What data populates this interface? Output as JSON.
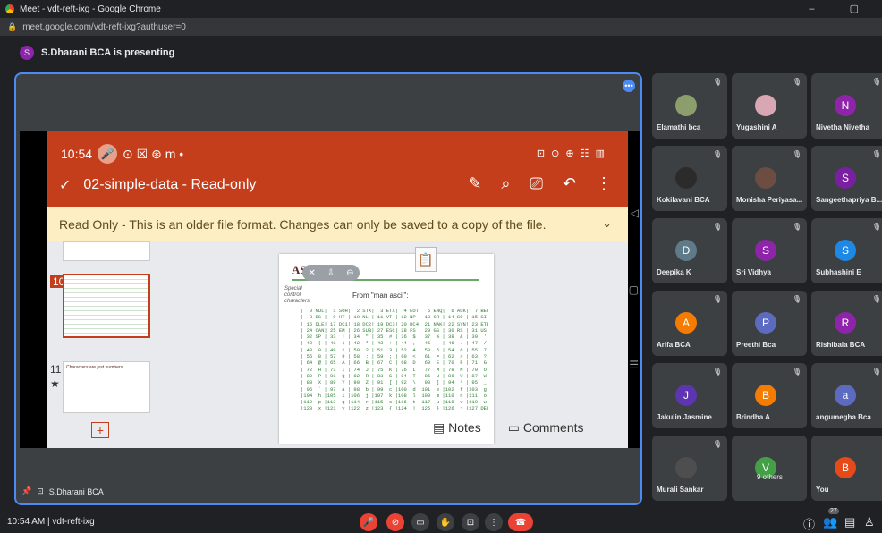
{
  "browser": {
    "title": "Meet - vdt-reft-ixg - Google Chrome",
    "url": "meet.google.com/vdt-reft-ixg?authuser=0",
    "window_controls": "–  ▢"
  },
  "presenter": {
    "initial": "S",
    "text": "S.Dharani BCA is presenting",
    "footer_name": "S.Dharani BCA"
  },
  "phone": {
    "time": "10:54",
    "status_icons": "⊙ ☒ ⊛ m •",
    "sys_icons": "⊡ ⊙ ⊕ ☷ ▥",
    "file_title": "02-simple-data - Read-only",
    "banner": "Read Only - This is an older file format. Changes can only be saved to a copy of the file.",
    "thumb_numbers": [
      "10",
      "11"
    ],
    "thumb11_title": "Characters are just numbers",
    "slide_title": "ASCII",
    "special_label": "Special control characters",
    "from_text": "From \"man ascii\":",
    "notes": "Notes",
    "comments": "Comments"
  },
  "ascii_rows": [
    "|  0 NUL|  1 SOH|  2 STX|  3 ETX|  4 EOT|  5 ENQ|  6 ACK|  7 BEL|",
    "|  8 BS |  9 HT | 10 NL | 11 VT | 12 NP | 13 CR | 14 SO | 15 SI |",
    "| 16 DLE| 17 DC1| 18 DC2| 19 DC3| 20 DC4| 21 NAK| 22 SYN| 23 ETB|",
    "| 24 CAN| 25 EM | 26 SUB| 27 ESC| 28 FS | 29 GS | 30 RS | 31 US |",
    "| 32 SP | 33  ! | 34  \" | 35  # | 36  $ | 37  % | 38  & | 39  ' |",
    "| 40  ( | 41  ) | 42  * | 43  + | 44  , | 45  - | 46  . | 47  / |",
    "| 48  0 | 49  1 | 50  2 | 51  3 | 52  4 | 53  5 | 54  6 | 55  7 |",
    "| 56  8 | 57  9 | 58  : | 59  ; | 60  < | 61  = | 62  > | 63  ? |",
    "| 64  @ | 65  A | 66  B | 67  C | 68  D | 69  E | 70  F | 71  G |",
    "| 72  H | 73  I | 74  J | 75  K | 76  L | 77  M | 78  N | 79  O |",
    "| 80  P | 81  Q | 82  R | 83  S | 84  T | 85  U | 86  V | 87  W |",
    "| 88  X | 89  Y | 90  Z | 91  [ | 92  \\ | 93  ] | 94  ^ | 95  _ |",
    "| 96  ` | 97  a | 98  b | 99  c |100  d |101  e |102  f |103  g |",
    "|104  h |105  i |106  j |107  k |108  l |109  m |110  n |111  o |",
    "|112  p |113  q |114  r |115  s |116  t |117  u |118  v |119  w |",
    "|120  x |121  y |122  z |123  { |124  | |125  } |126  ~ |127 DEL|"
  ],
  "participants": [
    {
      "name": "Elamathi bca",
      "initial": "",
      "color": "#8b9e6b"
    },
    {
      "name": "Yugashini A",
      "initial": "",
      "color": "#d9a6b3"
    },
    {
      "name": "Nivetha Nivetha",
      "initial": "N",
      "color": "#8e24aa"
    },
    {
      "name": "Kokilavani BCA",
      "initial": "",
      "color": "#2b2b2b"
    },
    {
      "name": "Monisha Periyasa...",
      "initial": "",
      "color": "#6d4c41"
    },
    {
      "name": "Sangeethapriya B...",
      "initial": "S",
      "color": "#7b1fa2"
    },
    {
      "name": "Deepika K",
      "initial": "D",
      "color": "#5f7b8a"
    },
    {
      "name": "Sri Vidhya",
      "initial": "S",
      "color": "#8e24aa"
    },
    {
      "name": "Subhashini E",
      "initial": "S",
      "color": "#1e88e5"
    },
    {
      "name": "Arifa BCA",
      "initial": "A",
      "color": "#f57c00"
    },
    {
      "name": "Preethi Bca",
      "initial": "P",
      "color": "#5c6bc0"
    },
    {
      "name": "Rishibala BCA",
      "initial": "R",
      "color": "#8e24aa"
    },
    {
      "name": "Jakulin Jasmine",
      "initial": "J",
      "color": "#5e35b1"
    },
    {
      "name": "Brindha A",
      "initial": "B",
      "color": "#f57c00"
    },
    {
      "name": "angumegha Bca",
      "initial": "a",
      "color": "#5c6bc0"
    },
    {
      "name": "Murali Sankar",
      "initial": "",
      "color": "#4e4e4e"
    },
    {
      "name": "9 others",
      "initial": "V",
      "color": "#43a047"
    },
    {
      "name": "You",
      "initial": "B",
      "color": "#e64a19"
    }
  ],
  "footer": {
    "time_meeting": "10:54 AM  |  vdt-reft-ixg",
    "people_count": "27"
  }
}
